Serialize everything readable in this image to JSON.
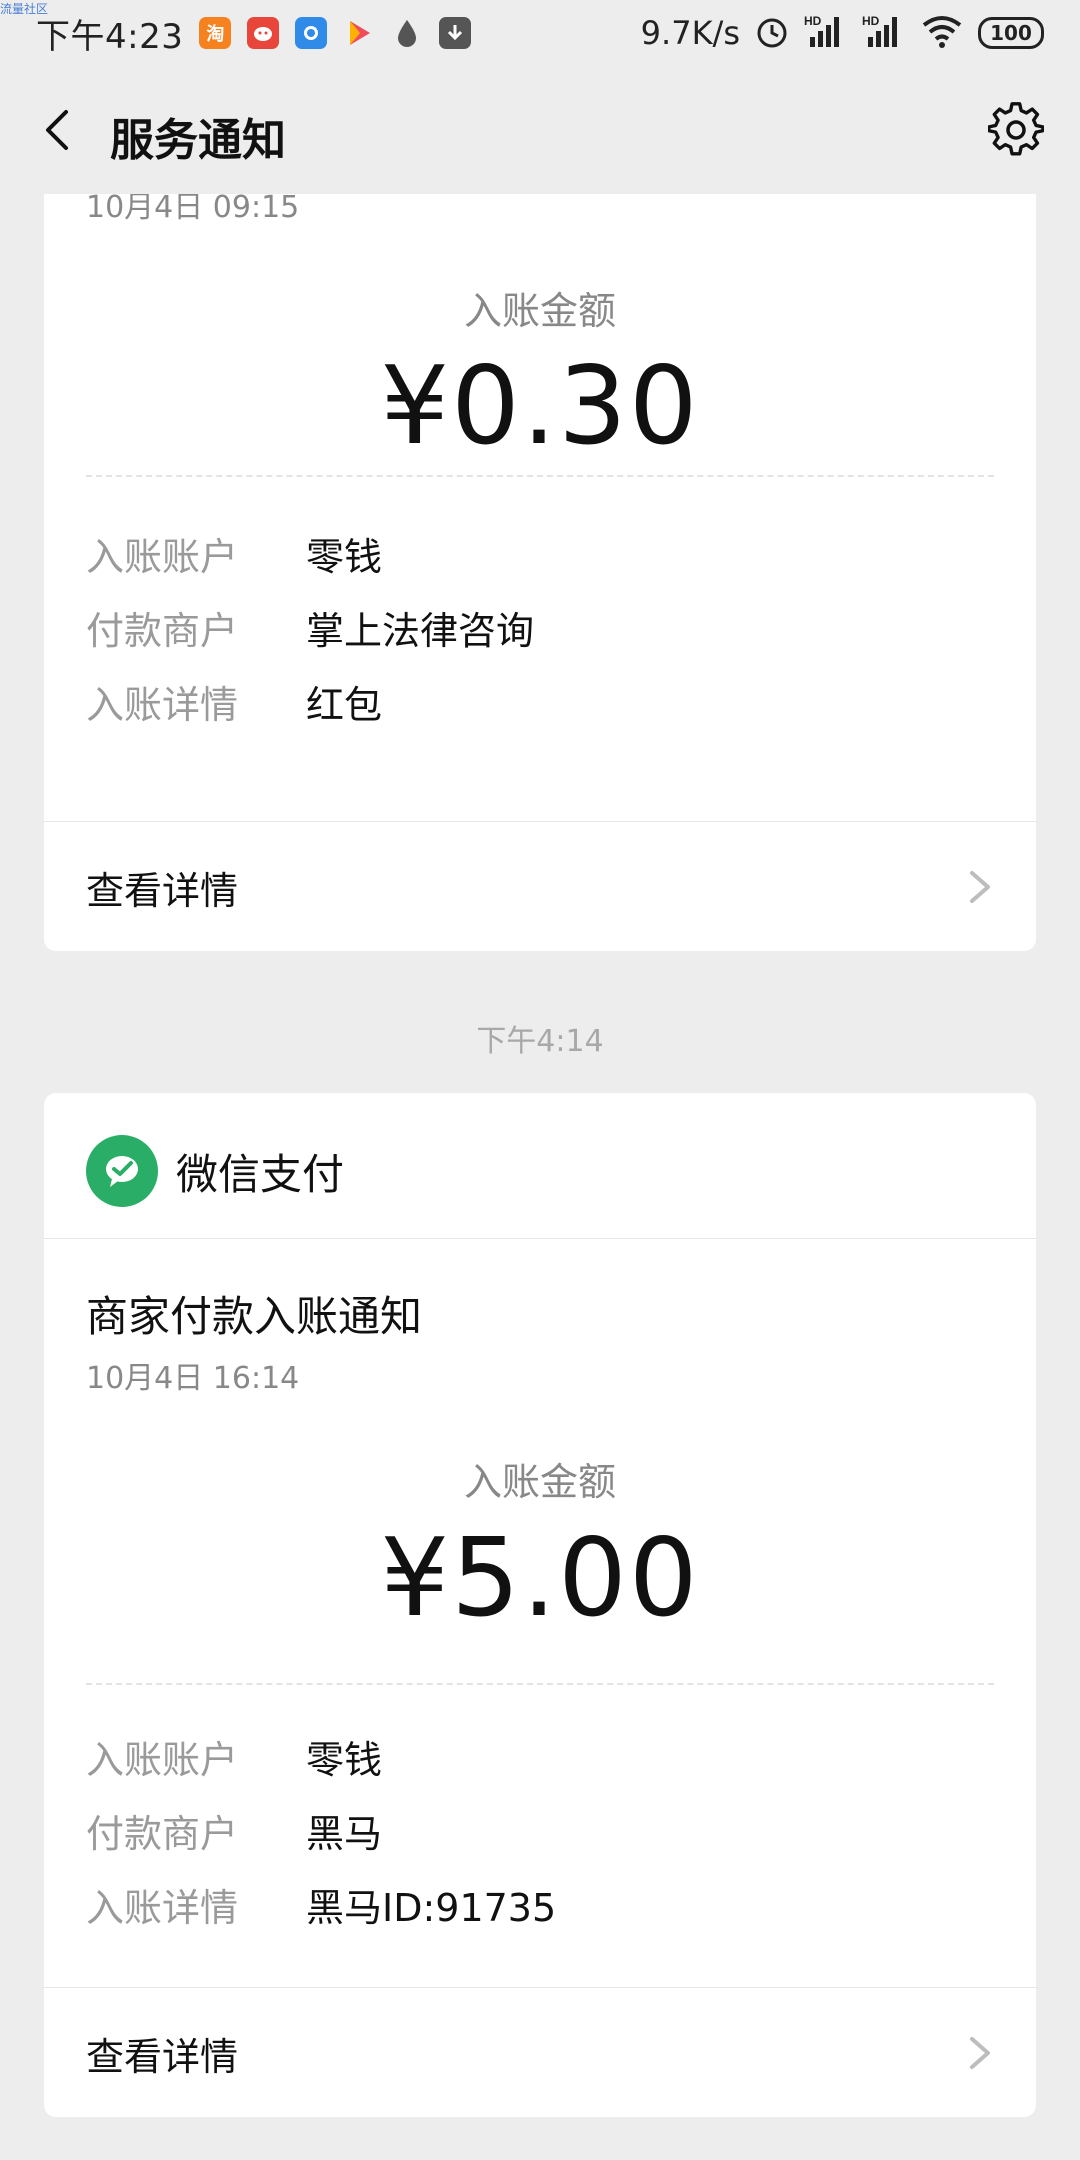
{
  "watermark": "流量社区",
  "status_bar": {
    "time": "下午4:23",
    "network_speed": "9.7K/s",
    "battery": "100",
    "app_icons": [
      "taobao-app-icon",
      "pig-app-icon",
      "blue-app-icon",
      "play-app-icon",
      "drop-app-icon",
      "download-app-icon"
    ],
    "signal_icons": [
      "alarm-icon",
      "signal-hd-icon",
      "signal-hd-icon",
      "wifi-icon"
    ]
  },
  "header": {
    "title": "服务通知",
    "back_icon": "chevron-left-icon",
    "settings_icon": "gear-icon"
  },
  "colors": {
    "wechat_pay_green": "#2aae67",
    "background": "#ededed"
  },
  "cards": [
    {
      "date": "10月4日  09:15",
      "amount_label": "入账金额",
      "amount": "¥0.30",
      "rows": [
        {
          "key": "入账账户",
          "value": "零钱"
        },
        {
          "key": "付款商户",
          "value": "掌上法律咨询"
        },
        {
          "key": "入账详情",
          "value": "红包"
        }
      ],
      "detail_label": "查看详情"
    },
    {
      "time_separator": "下午4:14",
      "brand": "微信支付",
      "title": "商家付款入账通知",
      "date": "10月4日  16:14",
      "amount_label": "入账金额",
      "amount": "¥5.00",
      "rows": [
        {
          "key": "入账账户",
          "value": "零钱"
        },
        {
          "key": "付款商户",
          "value": "黑马"
        },
        {
          "key": "入账详情",
          "value": "黑马ID:91735"
        }
      ],
      "detail_label": "查看详情"
    }
  ]
}
